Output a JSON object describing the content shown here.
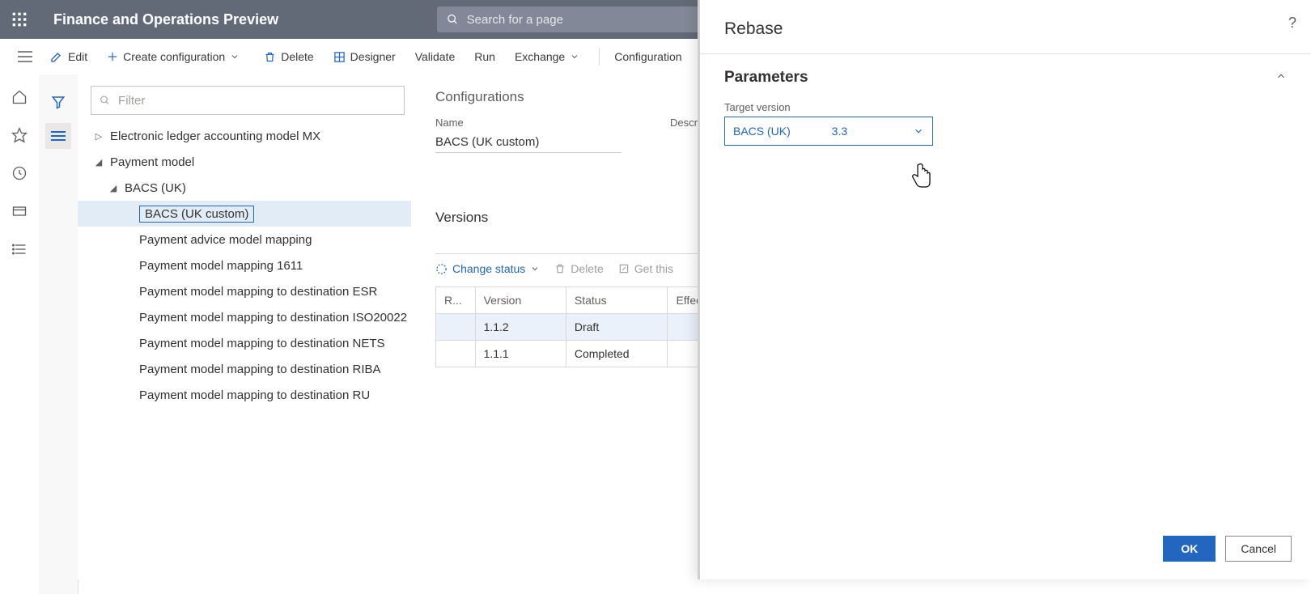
{
  "app_title": "Finance and Operations Preview",
  "search_placeholder": "Search for a page",
  "commands": {
    "edit": "Edit",
    "create_config": "Create configuration",
    "delete": "Delete",
    "designer": "Designer",
    "validate": "Validate",
    "run": "Run",
    "exchange": "Exchange",
    "configurations": "Configuration"
  },
  "filter_placeholder": "Filter",
  "tree": {
    "item0": "Electronic ledger accounting model MX",
    "item1": "Payment model",
    "item2": "BACS (UK)",
    "item3": "BACS (UK custom)",
    "item4": "Payment advice model mapping",
    "item5": "Payment model mapping 1611",
    "item6": "Payment model mapping to destination ESR",
    "item7": "Payment model mapping to destination ISO20022",
    "item8": "Payment model mapping to destination NETS",
    "item9": "Payment model mapping to destination RIBA",
    "item10": "Payment model mapping to destination RU"
  },
  "detail": {
    "heading": "Configurations",
    "name_label": "Name",
    "name_value": "BACS (UK custom)",
    "desc_label": "Description",
    "versions_heading": "Versions",
    "change_status": "Change status",
    "delete_label": "Delete",
    "get_this": "Get this",
    "col_r": "R...",
    "col_version": "Version",
    "col_status": "Status",
    "col_effect": "Effect",
    "rows": {
      "r0": {
        "version": "1.1.2",
        "status": "Draft"
      },
      "r1": {
        "version": "1.1.1",
        "status": "Completed"
      }
    }
  },
  "panel": {
    "title": "Rebase",
    "section": "Parameters",
    "target_label": "Target version",
    "target_text": "BACS (UK)",
    "target_version": "3.3",
    "ok": "OK",
    "cancel": "Cancel"
  }
}
